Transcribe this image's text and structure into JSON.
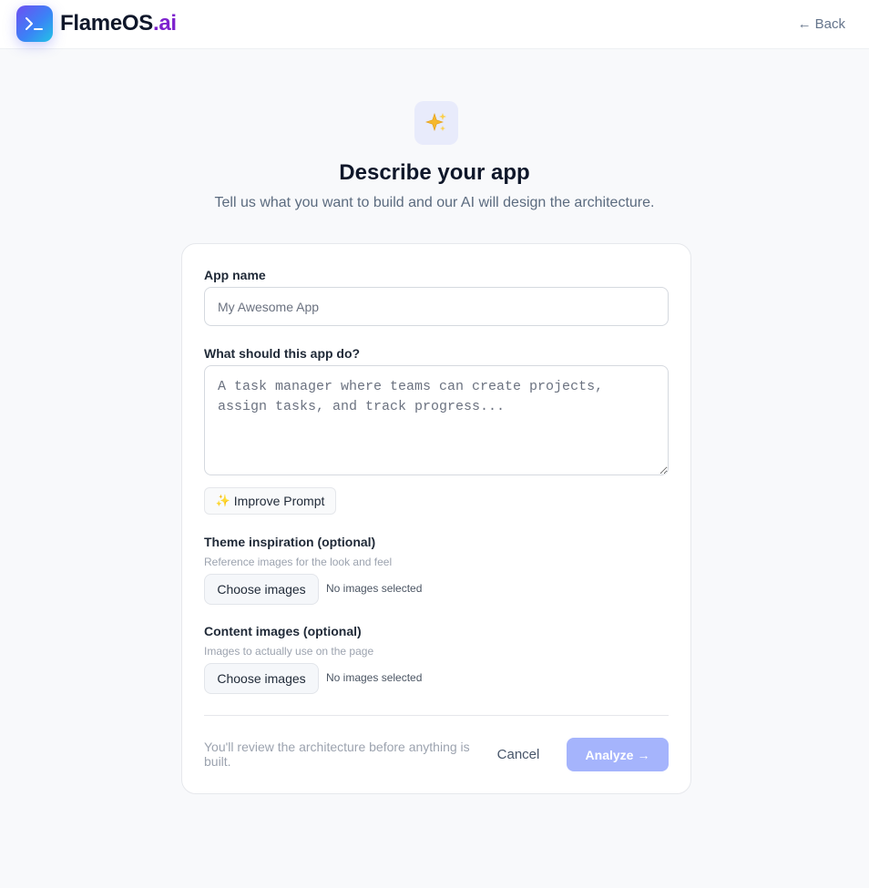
{
  "header": {
    "brand_main": "FlameOS",
    "brand_suffix": ".ai",
    "logo_icon": "terminal-prompt-icon",
    "back_label": "Back",
    "back_icon": "arrow-left-icon"
  },
  "hero": {
    "icon": "sparkles-icon",
    "title": "Describe your app",
    "subtitle": "Tell us what you want to build and our AI will design the architecture."
  },
  "form": {
    "app_name": {
      "label": "App name",
      "value": "",
      "placeholder": "My Awesome App"
    },
    "description": {
      "label": "What should this app do?",
      "value": "",
      "placeholder": "A task manager where teams can create projects, assign tasks, and track progress..."
    },
    "improve_prompt": {
      "icon": "sparkles-icon",
      "label": "Improve Prompt"
    },
    "theme_images": {
      "label": "Theme inspiration (optional)",
      "hint": "Reference images for the look and feel",
      "button_label": "Choose images",
      "status": "No images selected"
    },
    "content_images": {
      "label": "Content images (optional)",
      "hint": "Images to actually use on the page",
      "button_label": "Choose images",
      "status": "No images selected"
    },
    "footer": {
      "note": "You'll review the architecture before anything is built.",
      "cancel_label": "Cancel",
      "analyze_label": "Analyze",
      "analyze_icon": "arrow-right-icon"
    }
  },
  "colors": {
    "accent_gradient_start": "#6d4ff2",
    "accent_gradient_end": "#22c3e6",
    "brand_suffix": "#7e22ce",
    "analyze_button": "#a5b4fc",
    "page_background": "#f8f9fb"
  }
}
